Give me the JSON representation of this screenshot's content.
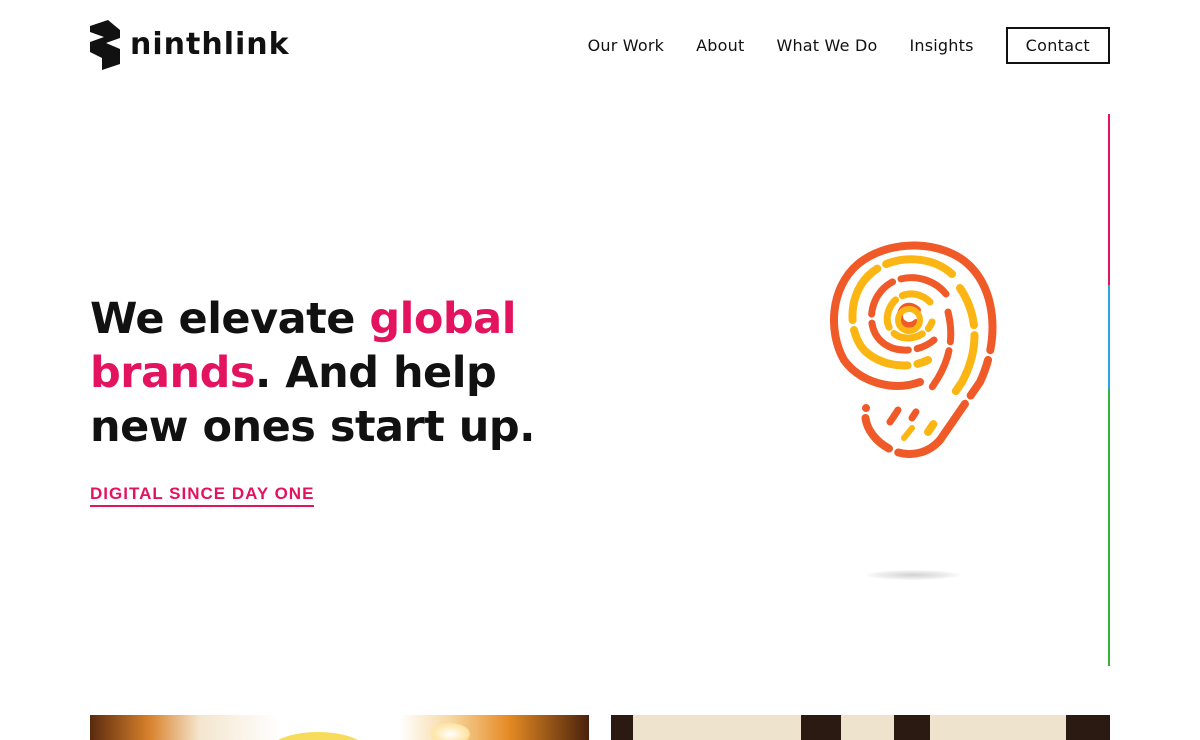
{
  "header": {
    "logo_text": "ninthlink",
    "nav": [
      {
        "label": "Our Work"
      },
      {
        "label": "About"
      },
      {
        "label": "What We Do"
      },
      {
        "label": "Insights"
      }
    ],
    "contact_label": "Contact"
  },
  "hero": {
    "title_part1": "We elevate ",
    "title_accent": "global brands",
    "title_part2": ". And help new ones start up.",
    "cta_label": "DIGITAL SINCE DAY ONE",
    "graphic_icon": "ninthlink-nine-fingerprint-icon"
  },
  "colors": {
    "accent": "#e4135f",
    "text": "#111111",
    "graphic_orange": "#f05a28",
    "graphic_yellow": "#fbb614",
    "line_pink": "#e4135f",
    "line_blue": "#2aa6df",
    "line_green": "#34b53a"
  }
}
